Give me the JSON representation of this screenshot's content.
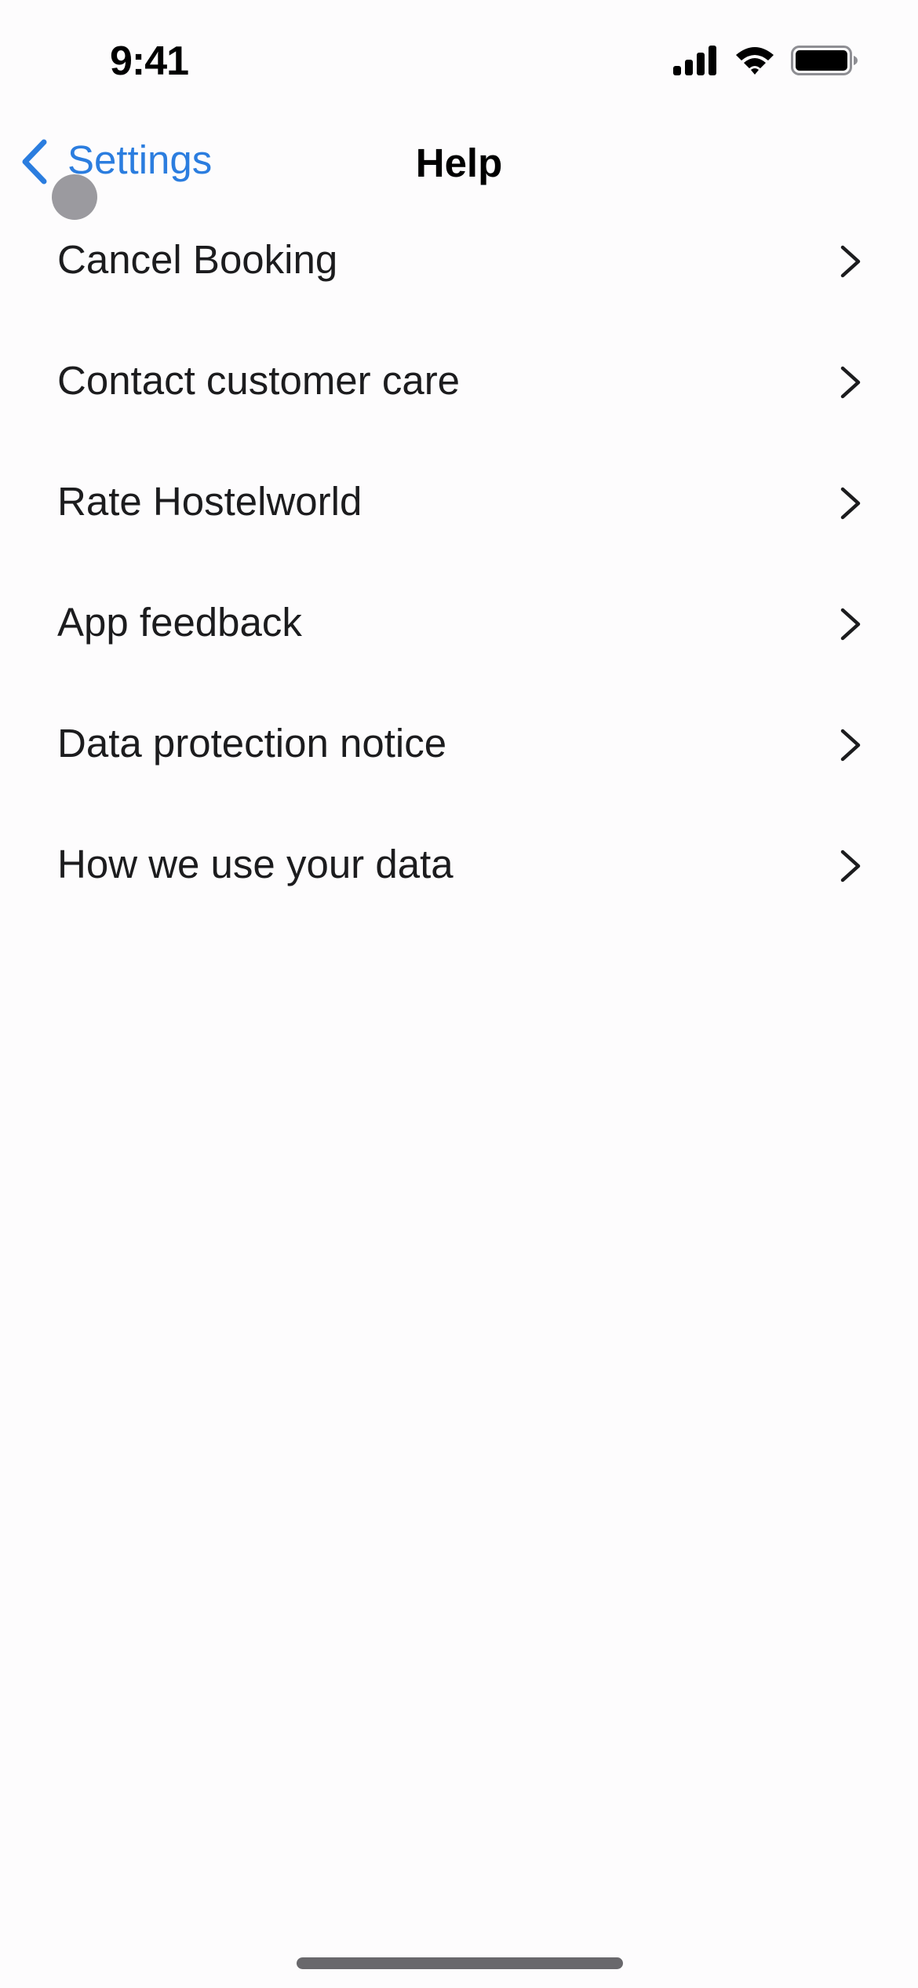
{
  "status_bar": {
    "time": "9:41",
    "icons": [
      "signal-icon",
      "wifi-icon",
      "battery-icon"
    ]
  },
  "nav": {
    "back_label": "Settings",
    "back_icon": "chevron-left-icon",
    "title": "Help",
    "accent_color": "#2b7ddf"
  },
  "help_items": [
    {
      "label": "Cancel Booking",
      "icon": "chevron-right-icon"
    },
    {
      "label": "Contact customer care",
      "icon": "chevron-right-icon"
    },
    {
      "label": "Rate Hostelworld",
      "icon": "chevron-right-icon"
    },
    {
      "label": "App feedback",
      "icon": "chevron-right-icon"
    },
    {
      "label": "Data protection notice",
      "icon": "chevron-right-icon"
    },
    {
      "label": "How we use your data",
      "icon": "chevron-right-icon"
    }
  ]
}
